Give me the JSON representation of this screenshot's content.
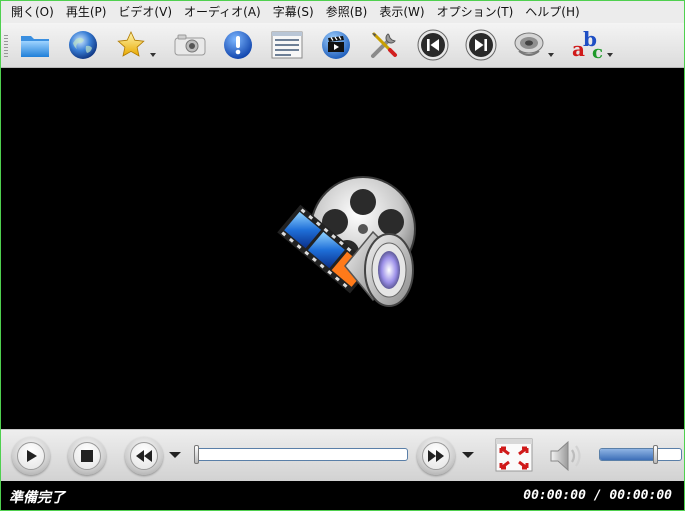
{
  "menu": [
    {
      "label": "開く(O)"
    },
    {
      "label": "再生(P)"
    },
    {
      "label": "ビデオ(V)"
    },
    {
      "label": "オーディオ(A)"
    },
    {
      "label": "字幕(S)"
    },
    {
      "label": "参照(B)"
    },
    {
      "label": "表示(W)"
    },
    {
      "label": "オプション(T)"
    },
    {
      "label": "ヘルプ(H)"
    }
  ],
  "toolbar": {
    "icons": [
      "folder-icon",
      "globe-icon",
      "star-icon",
      "camera-icon",
      "info-icon",
      "playlist-icon",
      "clapper-icon",
      "tools-icon",
      "previous-icon",
      "next-icon",
      "audio-track-icon",
      "subtitle-icon"
    ],
    "subtitle_letters": {
      "a": "a",
      "b": "b",
      "c": "c"
    }
  },
  "seek": {
    "position": 0.0
  },
  "volume": {
    "level": 0.68
  },
  "status": {
    "message": "準備完了",
    "time": "00:00:00 / 00:00:00"
  },
  "colors": {
    "accent": "#3d6fb8",
    "window_border": "#4fd04f"
  }
}
